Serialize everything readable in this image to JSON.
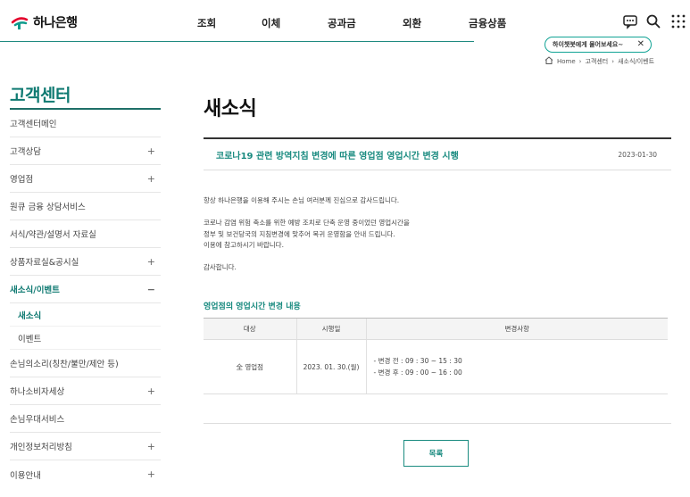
{
  "header": {
    "logo_text": "하나은행",
    "nav": [
      "조회",
      "이체",
      "공과금",
      "외환",
      "금융상품"
    ],
    "chat_tooltip": "하이챗봇에게 물어보세요~",
    "chat_close": "✕",
    "breadcrumb": [
      "Home",
      "고객센터",
      "새소식/이벤트"
    ],
    "brand_color": "#0f7a72"
  },
  "sidebar": {
    "title": "고객센터",
    "items": [
      {
        "label": "고객센터메인",
        "toggle": ""
      },
      {
        "label": "고객상담",
        "toggle": "+"
      },
      {
        "label": "영업점",
        "toggle": "+"
      },
      {
        "label": "원큐 금융 상담서비스",
        "toggle": ""
      },
      {
        "label": "서식/약관/설명서 자료실",
        "toggle": ""
      },
      {
        "label": "상품자료실&공시실",
        "toggle": "+"
      },
      {
        "label": "새소식/이벤트",
        "toggle": "−"
      }
    ],
    "sub_items": [
      "새소식",
      "이벤트"
    ],
    "items_after": [
      {
        "label": "손님의소리(칭찬/불만/제안 등)",
        "toggle": ""
      },
      {
        "label": "하나소비자세상",
        "toggle": "+"
      },
      {
        "label": "손님우대서비스",
        "toggle": ""
      },
      {
        "label": "개인정보처리방침",
        "toggle": "+"
      },
      {
        "label": "이용안내",
        "toggle": "+"
      }
    ]
  },
  "main": {
    "page_title": "새소식",
    "post_title": "코로나19 관련 방역지침 변경에 따른 영업점 영업시간 변경 시행",
    "post_date": "2023-01-30",
    "body": {
      "p1": "항상 하나은행을 이용해 주시는 손님 여러분께 진심으로 감사드립니다.",
      "p2_l1": "코로나 감염 위험 축소를 위한 예방 조치로 단축 운영 중이었던 영업시간을",
      "p2_l2": "정부 및 보건당국의 지침변경에 맞추어 복귀 운영함을 안내 드립니다.",
      "p2_l3": "이용에 참고하시기 바랍니다.",
      "p3": "감사합니다."
    },
    "section_title": "영업점의 영업시간 변경 내용",
    "table": {
      "headers": [
        "대상",
        "시행일",
        "변경사항"
      ],
      "row": {
        "target": "全 영업점",
        "date": "2023. 01. 30.(월)",
        "before": "- 변경 전 : 09 : 30 ~ 15 : 30",
        "after": "- 변경 후 : 09 : 00 ~ 16 : 00"
      }
    },
    "list_button": "목록"
  }
}
